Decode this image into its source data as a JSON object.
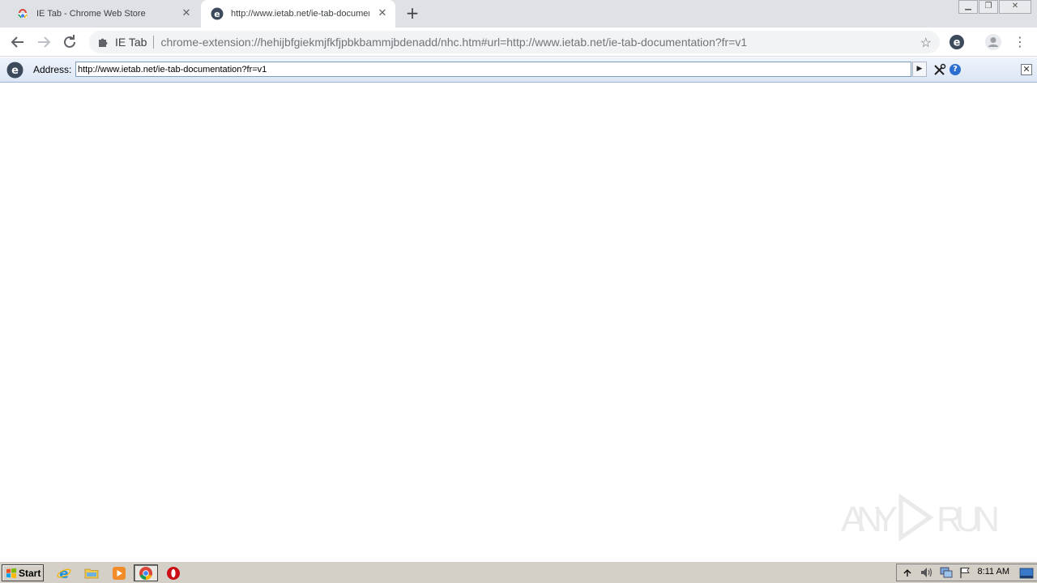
{
  "browser": {
    "tabs": [
      {
        "title": "IE Tab - Chrome Web Store",
        "favicon": "chrome-web-store-icon",
        "active": false
      },
      {
        "title": "http://www.ietab.net/ie-tab-documentation?fr=v1",
        "favicon": "ie-tab-icon",
        "active": true
      }
    ],
    "new_tab": "+",
    "omnibox": {
      "extension_label": "IE Tab",
      "url": "chrome-extension://hehijbfgiekmjfkfjpbkbammjbdenadd/nhc.htm#url=http://www.ietab.net/ie-tab-documentation?fr=v1"
    }
  },
  "ietab_bar": {
    "address_label": "Address:",
    "address_value": "http://www.ietab.net/ie-tab-documentation?fr=v1"
  },
  "watermark": {
    "text": "ANY RUN"
  },
  "taskbar": {
    "start_label": "Start",
    "apps": [
      "internet-explorer-icon",
      "file-explorer-icon",
      "media-player-icon",
      "chrome-icon",
      "opera-icon"
    ],
    "clock": "8:11 AM"
  },
  "colors": {
    "tabstrip_bg": "#dee1e6",
    "ietab_bar_bg": "#dce6f5",
    "taskbar_bg": "#d4d0c8",
    "accent": "#2b6fd1"
  }
}
